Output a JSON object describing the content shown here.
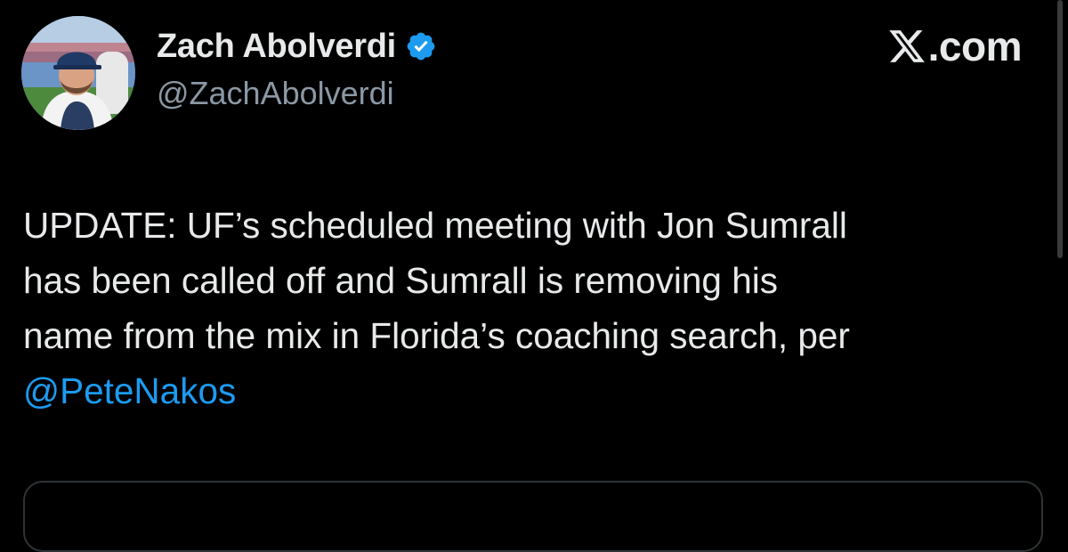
{
  "post": {
    "author": {
      "display_name": "Zach Abolverdi",
      "handle": "@ZachAbolverdi",
      "verified_icon": "verified-badge-icon",
      "avatar_icon": "avatar"
    },
    "site": {
      "logo_icon": "x-logo-icon",
      "domain": ".com"
    },
    "text_lines": [
      "UPDATE: UF’s scheduled meeting with Jon Sumrall",
      "has been called off and Sumrall is removing his",
      "name from the mix in Florida’s coaching search, per"
    ],
    "mention": "@PeteNakos"
  },
  "colors": {
    "background": "#000000",
    "text": "#e7e9ea",
    "secondary_text": "#8b98a5",
    "link": "#1d9bf0",
    "verified": "#1d9bf0",
    "card_border": "#2f3336"
  }
}
